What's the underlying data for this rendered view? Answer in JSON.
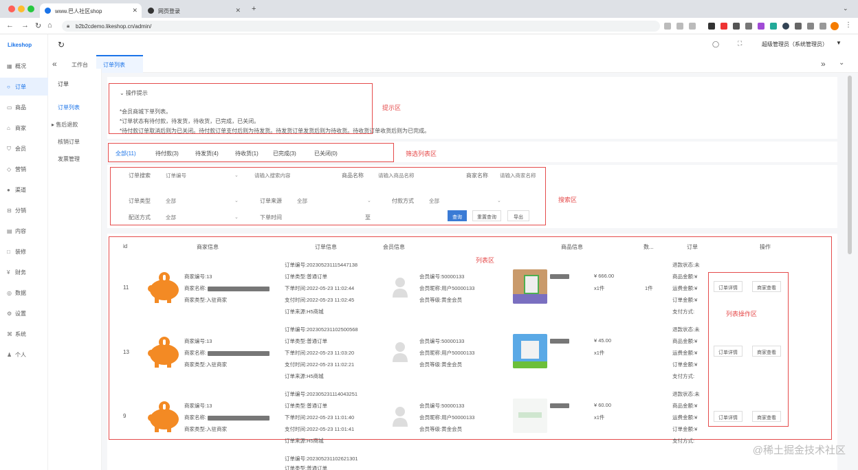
{
  "browser": {
    "tabs": [
      {
        "title": "www.巴人社区shop"
      },
      {
        "title": "网页登录"
      }
    ],
    "url": "b2b2cdemo.likeshop.cn/admin/",
    "colors": {
      "red": "#ff5f57",
      "yellow": "#febc2e",
      "green": "#28c840"
    }
  },
  "app": {
    "logo": "Likeshop",
    "refresh_icon": "refresh-icon",
    "user": "超级管理员（系统管理员）"
  },
  "sidebar": {
    "items": [
      {
        "label": "概况",
        "icon": "grid-icon"
      },
      {
        "label": "订单",
        "icon": "circle-icon"
      },
      {
        "label": "商品",
        "icon": "box-icon"
      },
      {
        "label": "商家",
        "icon": "store-icon"
      },
      {
        "label": "会员",
        "icon": "person-icon"
      },
      {
        "label": "营销",
        "icon": "tag-icon"
      },
      {
        "label": "渠道",
        "icon": "channel-icon"
      },
      {
        "label": "分销",
        "icon": "share-icon"
      },
      {
        "label": "内容",
        "icon": "doc-icon"
      },
      {
        "label": "装修",
        "icon": "brush-icon"
      },
      {
        "label": "财务",
        "icon": "money-icon"
      },
      {
        "label": "数据",
        "icon": "chart-icon"
      },
      {
        "label": "设置",
        "icon": "gear-icon"
      },
      {
        "label": "系统",
        "icon": "system-icon"
      },
      {
        "label": "个人",
        "icon": "user-icon"
      }
    ]
  },
  "subsidebar": {
    "title": "订单",
    "items": [
      {
        "label": "订单列表"
      },
      {
        "label": "售后退款"
      },
      {
        "label": "核销订单"
      },
      {
        "label": "发票管理"
      }
    ]
  },
  "page_tabs": [
    {
      "label": "工作台"
    },
    {
      "label": "订单列表"
    }
  ],
  "tips": {
    "title": "操作提示",
    "lines": [
      "*会员商城下单列表。",
      "*订单状态有待付款，待发货，待收货，已完成，已关闭。",
      "*待付款订单取消后则为已关闭。待付款订单支付后则为待发货。待发货订单发货后则为待收货。待收货订单收货后则为已完成。"
    ],
    "annotation": "提示区"
  },
  "filter_tabs": {
    "items": [
      {
        "label": "全部(11)"
      },
      {
        "label": "待付款(3)"
      },
      {
        "label": "待发货(4)"
      },
      {
        "label": "待收货(1)"
      },
      {
        "label": "已完成(3)"
      },
      {
        "label": "已关闭(0)"
      }
    ],
    "annotation": "筛选列表区"
  },
  "search": {
    "annotation": "搜索区",
    "order_search_label": "订单搜索",
    "order_search_select": "订单编号",
    "order_search_placeholder": "请输入搜索内容",
    "goods_name_label": "商品名称",
    "goods_name_placeholder": "请输入商品名称",
    "shop_name_label": "商家名称",
    "shop_name_placeholder": "请输入商家名称",
    "order_type_label": "订单类型",
    "order_type_value": "全部",
    "order_source_label": "订单来源",
    "order_source_value": "全部",
    "pay_method_label": "付款方式",
    "pay_method_value": "全部",
    "delivery_label": "配送方式",
    "delivery_value": "全部",
    "time_label": "下单时间",
    "time_sep": "至",
    "query_button": "查询",
    "reset_button": "重置查询",
    "export_button": "导出"
  },
  "table": {
    "annotation": "列表区",
    "action_annotation": "列表操作区",
    "headers": [
      "id",
      "商家信息",
      "订单信息",
      "会员信息",
      "商品信息",
      "数...",
      "订单",
      "操作"
    ],
    "rows": [
      {
        "id": "11",
        "shop": [
          "商家编号:13",
          "商家名称:",
          "商家类型:入驻商家"
        ],
        "order": [
          "订单编号:202305231115447138",
          "订单类型:普通订单",
          "下单时间:2022-05-23 11:02:44",
          "支付时间:2022-05-23 11:02:45",
          "订单来源:H5商城"
        ],
        "member": [
          "会员编号:50000133",
          "会员昵称:用户50000133",
          "会员等级:黄金会员"
        ],
        "goods_price": "¥ 666.00",
        "goods_qty": "x1件",
        "qty": "1件",
        "order_extra": [
          "退款状态:未",
          "商品金额:¥",
          "运费金额:¥",
          "订单金额:¥",
          "支付方式:"
        ],
        "actions": [
          "订单详情",
          "商家查看"
        ]
      },
      {
        "id": "13",
        "shop": [
          "商家编号:13",
          "商家名称:",
          "商家类型:入驻商家"
        ],
        "order": [
          "订单编号:202305231102500568",
          "订单类型:普通订单",
          "下单时间:2022-05-23 11:03:20",
          "支付时间:2022-05-23 11:02:21",
          "订单来源:H5商城"
        ],
        "member": [
          "会员编号:50000133",
          "会员昵称:用户50000133",
          "会员等级:黄金会员"
        ],
        "goods_price": "¥ 45.00",
        "goods_qty": "x1件",
        "qty": "",
        "order_extra": [
          "退款状态:未",
          "商品金额:¥",
          "运费金额:¥",
          "订单金额:¥",
          "支付方式:"
        ],
        "actions": [
          "订单详情",
          "商家查看"
        ]
      },
      {
        "id": "9",
        "shop": [
          "商家编号:13",
          "商家名称:",
          "商家类型:入驻商家"
        ],
        "order": [
          "订单编号:202305231114043251",
          "订单类型:普通订单",
          "下单时间:2022-05-23 11:01:40",
          "支付时间:2022-05-23 11:01:41",
          "订单来源:H5商城"
        ],
        "member": [
          "会员编号:50000133",
          "会员昵称:用户50000133",
          "会员等级:黄金会员"
        ],
        "goods_price": "¥ 60.00",
        "goods_qty": "x1件",
        "qty": "",
        "order_extra": [
          "退款状态:未",
          "商品金额:¥",
          "运费金额:¥",
          "订单金额:¥",
          "支付方式:"
        ],
        "actions": [
          "订单详情",
          "商家查看"
        ]
      }
    ],
    "partial_row": [
      "订单编号:202305231102621301",
      "订单类型:普通订单"
    ]
  },
  "watermark": "@稀土掘金技术社区"
}
